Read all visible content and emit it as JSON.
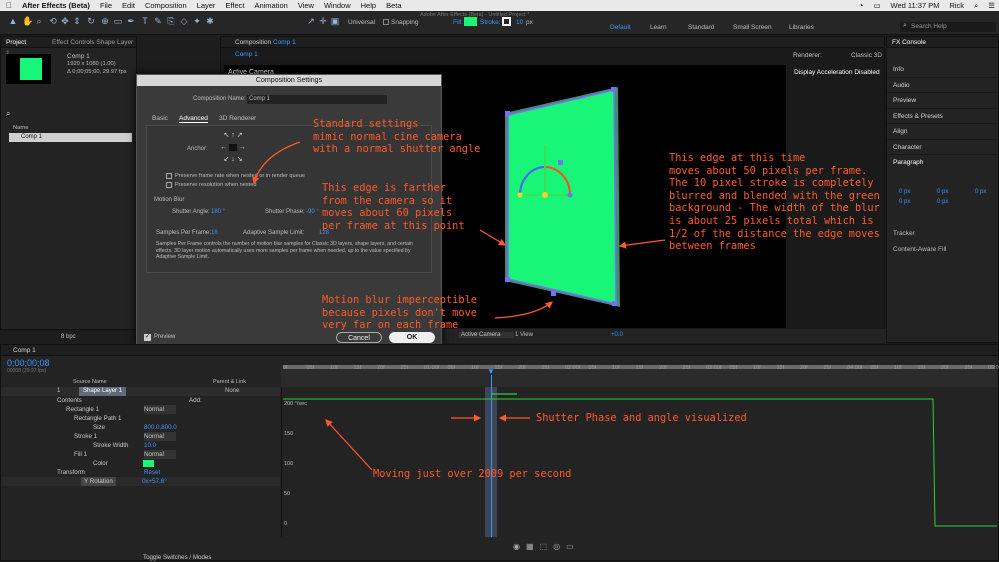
{
  "menubar": {
    "apple": "",
    "app": "After Effects (Beta)",
    "items": [
      "File",
      "Edit",
      "Composition",
      "Layer",
      "Effect",
      "Animation",
      "View",
      "Window",
      "Help",
      "Beta"
    ],
    "clock": "Wed 11:37 PM",
    "user": "Rick"
  },
  "window_title": "Adobe After Effects (Beta) - Untitled Project *",
  "toolbar": {
    "universal": "Universal",
    "snapping": "Snapping",
    "fill": "Fill:",
    "stroke": "Stroke:",
    "stroke_px": "10",
    "px": "px",
    "workspaces": [
      "Default",
      "Learn",
      "Small Screen",
      "Standard",
      "Libraries"
    ],
    "search": "Search Help"
  },
  "project": {
    "tab": "Project",
    "fx_tab": "Effect Controls Shape Layer 1",
    "name": "Comp 1",
    "res": "1920 x 1080 (1.00)",
    "dur": "Δ 0;00;05;00, 29.97 fps",
    "col": "Name",
    "item": "Comp 1",
    "bpc": "8 bpc"
  },
  "comp_panel": {
    "tab_prefix": "Composition",
    "tab_name": "Comp 1",
    "sub": "Comp 1",
    "renderer_label": "Renderer:",
    "renderer": "Classic 3D",
    "active_camera": "Active Camera",
    "accel": "Display Acceleration Disabled",
    "cam_dd": "Active Camera",
    "view_dd": "1 View",
    "exposure": "+0.0"
  },
  "dialog": {
    "title": "Composition Settings",
    "name_label": "Composition Name:",
    "name_value": "Comp 1",
    "tabs": [
      "Basic",
      "Advanced",
      "3D Renderer"
    ],
    "anchor": "Anchor:",
    "opt1": "Preserve frame rate when nested or in render queue",
    "opt2": "Preserve resolution when nested",
    "mb_title": "Motion Blur",
    "shutter_angle_label": "Shutter Angle:",
    "shutter_angle": "180 °",
    "shutter_phase_label": "Shutter Phase:",
    "shutter_phase": "-90 °",
    "spf_label": "Samples Per Frame:",
    "spf": "16",
    "asl_label": "Adaptive Sample Limit:",
    "asl": "128",
    "desc": "Samples Per Frame controls the number of motion blur samples for Classic 3D layers, shape layers, and certain effects. 3D layer motion automatically uses more samples per frame when needed, up to the value specified by Adaptive Sample Limit.",
    "preview": "Preview",
    "cancel": "Cancel",
    "ok": "OK"
  },
  "right_panel": {
    "tab": "FX Console",
    "items": [
      "Info",
      "Audio",
      "Preview",
      "Effects & Presets",
      "Align",
      "Character"
    ],
    "paragraph": "Paragraph",
    "px_vals": [
      "0 px",
      "0 px",
      "0 px",
      "0 px",
      "0 px"
    ],
    "items2": [
      "Tracker",
      "Content-Aware Fill"
    ]
  },
  "timeline": {
    "tab": "Comp 1",
    "timecode": "0;00;00;08",
    "fps": "00008 (29.97 fps)",
    "col_source": "Source Name",
    "col_parent": "Parent & Link",
    "layer_num": "1",
    "layer_name": "Shape Layer 1",
    "parent": "None",
    "contents": "Contents",
    "add": "Add:",
    "rect1": "Rectangle 1",
    "normal": "Normal",
    "rpath": "Rectangle Path 1",
    "size_label": "Size",
    "size_val": "800.0,800.0",
    "stroke1": "Stroke 1",
    "stroke_width_label": "Stroke Width",
    "stroke_width": "10.0",
    "fill1": "Fill 1",
    "color_label": "Color",
    "transform": "Transform",
    "reset": "Reset",
    "yrot_label": "Y Rotation",
    "yrot_val": "0x+57.6°",
    "toggle": "Toggle Switches / Modes",
    "ticks": [
      "0f",
      "05f",
      "10f",
      "15f",
      "20f",
      "25f",
      "01:00f",
      "05f",
      "10f",
      "15f",
      "20f",
      "25f",
      "02:00f",
      "05f",
      "10f",
      "15f",
      "20f",
      "25f",
      "03:00f",
      "05f",
      "10f",
      "15f",
      "20f",
      "25f",
      "04:00f",
      "05f",
      "10f",
      "15f",
      "20f",
      "25f",
      "05:0"
    ],
    "graph_y": [
      "200 °/sec",
      "150",
      "100",
      "50",
      "0"
    ]
  },
  "annotations": {
    "a1": "Standard settings\nmimic normal cine camera\nwith a normal shutter angle",
    "a2": "This edge is farther\nfrom the camera so it\nmoves about 60 pixels\nper frame at this point",
    "a3": "This edge at this time\nmoves about 50 pixels per frame.\nThe 10 pixel stroke is completely\nblurred and blended with the green\nbackground - The width of the blur\nis about 25 pixels total which is\n1/2 of the distance the edge moves\nbetween frames",
    "a4": "Motion blur imperceptible\nbecause pixels don't move\nvery far on each frame",
    "a5": "Shutter Phase and angle visualized",
    "a6": "Moving just over 2009 per second"
  },
  "colors": {
    "green": "#19f577",
    "accent": "#3f95ff",
    "annotation": "#ff5a2a"
  }
}
